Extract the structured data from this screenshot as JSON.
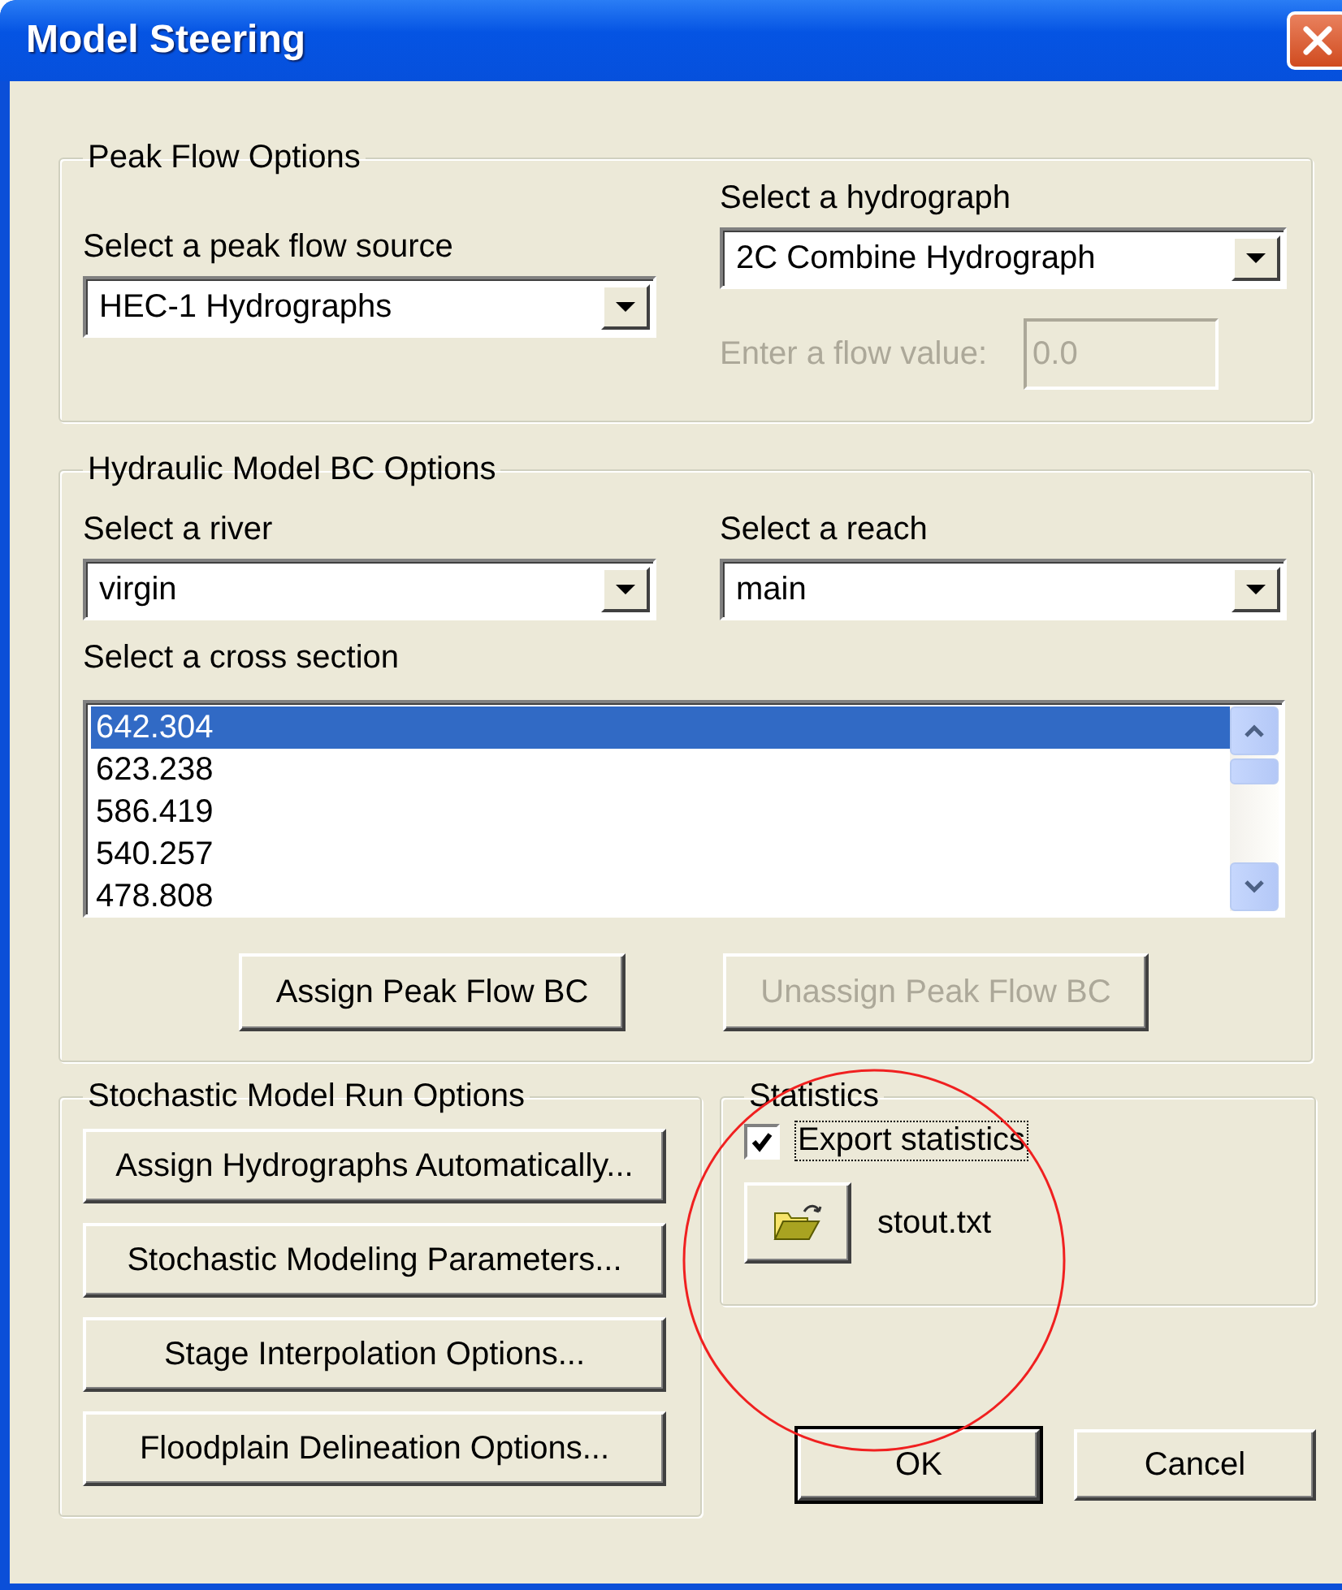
{
  "window": {
    "title": "Model Steering"
  },
  "peak_flow_options": {
    "title": "Peak Flow Options",
    "source_label": "Select a peak flow source",
    "source_value": "HEC-1 Hydrographs",
    "hydrograph_label": "Select a hydrograph",
    "hydrograph_value": "2C Combine Hydrograph",
    "flow_label": "Enter a flow value:",
    "flow_value": "0.0",
    "flow_disabled": true
  },
  "hydraulic_bc_options": {
    "title": "Hydraulic Model BC Options",
    "river_label": "Select a river",
    "river_value": "virgin",
    "reach_label": "Select a reach",
    "reach_value": "main",
    "cross_section_label": "Select a cross section",
    "cross_sections": [
      {
        "label": "642.304",
        "selected": true
      },
      {
        "label": "623.238",
        "selected": false
      },
      {
        "label": "586.419",
        "selected": false
      },
      {
        "label": "540.257",
        "selected": false
      },
      {
        "label": "478.808",
        "selected": false
      }
    ],
    "buttons": [
      {
        "label": "Assign Peak Flow BC",
        "disabled": false
      },
      {
        "label": "Unassign Peak Flow BC",
        "disabled": true
      }
    ]
  },
  "stochastic_options": {
    "title": "Stochastic Model Run Options",
    "buttons": [
      "Assign Hydrographs Automatically...",
      "Stochastic Modeling Parameters...",
      "Stage Interpolation Options...",
      "Floodplain Delineation Options..."
    ]
  },
  "statistics": {
    "title": "Statistics",
    "export_label": "Export statistics",
    "export_checked": true,
    "file_name": "stout.txt"
  },
  "buttons": [
    {
      "label": "OK",
      "default": true
    },
    {
      "label": "Cancel",
      "default": false
    }
  ]
}
